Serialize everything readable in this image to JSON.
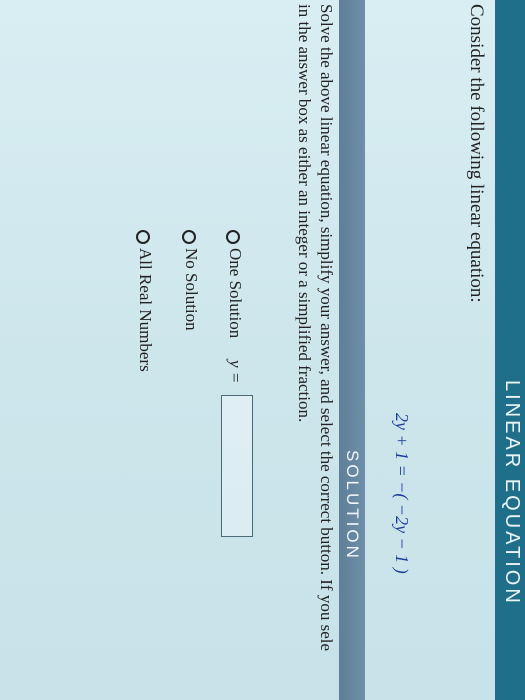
{
  "header": {
    "title": "LINEAR EQUATION"
  },
  "prompt": {
    "text": "Consider the following linear equation:"
  },
  "equation": {
    "text": "2y + 1 = −( −2y − 1 )"
  },
  "solution_header": {
    "title": "SOLUTION"
  },
  "instructions": {
    "line1": "Solve the above linear equation, simplify your answer, and select the correct button.  If you sele",
    "line2": "in the answer box as either an integer or a simplified fraction."
  },
  "options": [
    {
      "label": "One Solution"
    },
    {
      "label": "No Solution"
    },
    {
      "label": "All Real Numbers"
    }
  ],
  "answer": {
    "variable_label": "y =",
    "value": ""
  },
  "colors": {
    "header_band": "#1f6f8a",
    "solution_band": "#6f8fa8",
    "equation": "#1f3f9a"
  }
}
